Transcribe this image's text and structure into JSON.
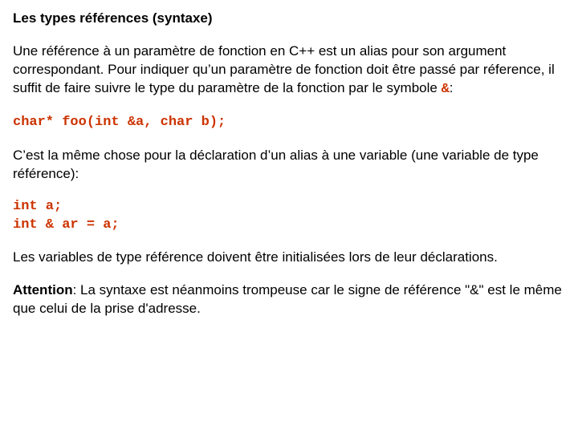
{
  "title": "Les types références (syntaxe)",
  "para1_a": "Une référence à un paramètre de fonction en C++ est un alias pour son argument correspondant. Pour indiquer qu’un paramètre de fonction doit être passé par réference, il suffit de faire suivre le type du paramètre de la fonction par le symbole ",
  "para1_sym": "&",
  "para1_b": ":",
  "code1": "char* foo(int &a, char b);",
  "para2": "C’est la même chose pour la déclaration d’un alias à une variable (une variable de type référence):",
  "code2": "int a;\nint & ar = a;",
  "para3": "Les variables de type référence doivent être initialisées lors de leur déclarations.",
  "attention_label": "Attention",
  "para4": ": La syntaxe est néanmoins trompeuse car le signe de référence \"&\" est le même que celui de la prise d'adresse."
}
